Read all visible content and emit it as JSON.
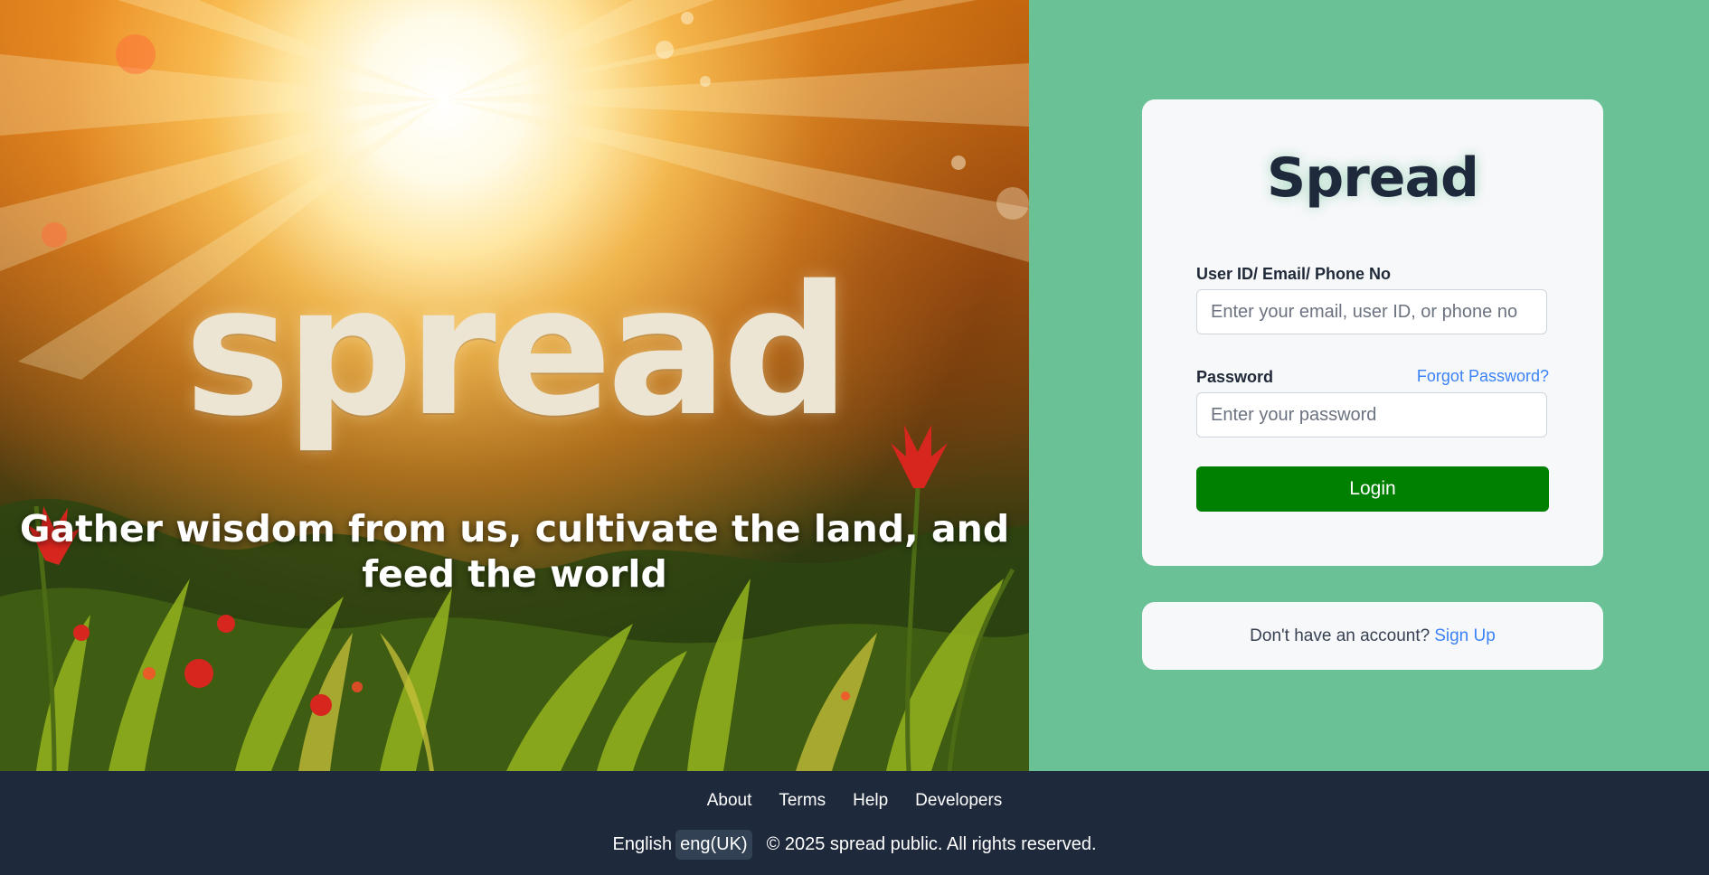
{
  "hero": {
    "word": "spread",
    "tagline": "Gather wisdom from us, cultivate the land, and feed the world"
  },
  "login": {
    "brand": "Spread",
    "user_label": "User ID/ Email/ Phone No",
    "user_placeholder": "Enter your email, user ID, or phone no",
    "password_label": "Password",
    "forgot_label": "Forgot Password?",
    "password_placeholder": "Enter your password",
    "login_button": "Login"
  },
  "signup": {
    "prompt": "Don't have an account?",
    "link": "Sign Up"
  },
  "footer": {
    "links": [
      "About",
      "Terms",
      "Help",
      "Developers"
    ],
    "language_label": "English",
    "language_value": "eng(UK)",
    "copyright": "© 2025 spread public. All rights reserved."
  },
  "colors": {
    "panel_bg": "#6ac195",
    "card_bg": "#f7f8fa",
    "brand_text": "#1e293b",
    "login_button": "#008000",
    "link": "#3b82f6",
    "footer_bg": "#1e293b"
  },
  "icons": []
}
